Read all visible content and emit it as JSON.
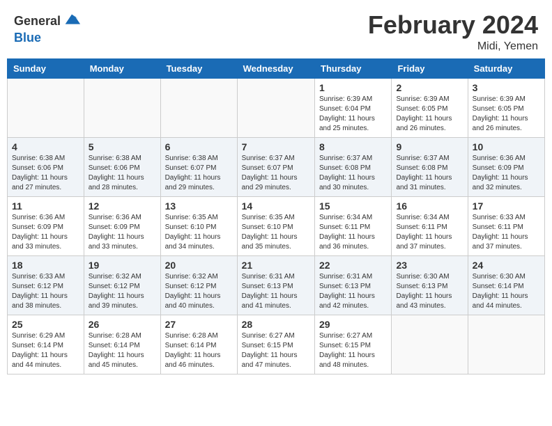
{
  "header": {
    "logo_general": "General",
    "logo_blue": "Blue",
    "month": "February 2024",
    "location": "Midi, Yemen"
  },
  "weekdays": [
    "Sunday",
    "Monday",
    "Tuesday",
    "Wednesday",
    "Thursday",
    "Friday",
    "Saturday"
  ],
  "weeks": [
    [
      {
        "day": "",
        "info": ""
      },
      {
        "day": "",
        "info": ""
      },
      {
        "day": "",
        "info": ""
      },
      {
        "day": "",
        "info": ""
      },
      {
        "day": "1",
        "info": "Sunrise: 6:39 AM\nSunset: 6:04 PM\nDaylight: 11 hours\nand 25 minutes."
      },
      {
        "day": "2",
        "info": "Sunrise: 6:39 AM\nSunset: 6:05 PM\nDaylight: 11 hours\nand 26 minutes."
      },
      {
        "day": "3",
        "info": "Sunrise: 6:39 AM\nSunset: 6:05 PM\nDaylight: 11 hours\nand 26 minutes."
      }
    ],
    [
      {
        "day": "4",
        "info": "Sunrise: 6:38 AM\nSunset: 6:06 PM\nDaylight: 11 hours\nand 27 minutes."
      },
      {
        "day": "5",
        "info": "Sunrise: 6:38 AM\nSunset: 6:06 PM\nDaylight: 11 hours\nand 28 minutes."
      },
      {
        "day": "6",
        "info": "Sunrise: 6:38 AM\nSunset: 6:07 PM\nDaylight: 11 hours\nand 29 minutes."
      },
      {
        "day": "7",
        "info": "Sunrise: 6:37 AM\nSunset: 6:07 PM\nDaylight: 11 hours\nand 29 minutes."
      },
      {
        "day": "8",
        "info": "Sunrise: 6:37 AM\nSunset: 6:08 PM\nDaylight: 11 hours\nand 30 minutes."
      },
      {
        "day": "9",
        "info": "Sunrise: 6:37 AM\nSunset: 6:08 PM\nDaylight: 11 hours\nand 31 minutes."
      },
      {
        "day": "10",
        "info": "Sunrise: 6:36 AM\nSunset: 6:09 PM\nDaylight: 11 hours\nand 32 minutes."
      }
    ],
    [
      {
        "day": "11",
        "info": "Sunrise: 6:36 AM\nSunset: 6:09 PM\nDaylight: 11 hours\nand 33 minutes."
      },
      {
        "day": "12",
        "info": "Sunrise: 6:36 AM\nSunset: 6:09 PM\nDaylight: 11 hours\nand 33 minutes."
      },
      {
        "day": "13",
        "info": "Sunrise: 6:35 AM\nSunset: 6:10 PM\nDaylight: 11 hours\nand 34 minutes."
      },
      {
        "day": "14",
        "info": "Sunrise: 6:35 AM\nSunset: 6:10 PM\nDaylight: 11 hours\nand 35 minutes."
      },
      {
        "day": "15",
        "info": "Sunrise: 6:34 AM\nSunset: 6:11 PM\nDaylight: 11 hours\nand 36 minutes."
      },
      {
        "day": "16",
        "info": "Sunrise: 6:34 AM\nSunset: 6:11 PM\nDaylight: 11 hours\nand 37 minutes."
      },
      {
        "day": "17",
        "info": "Sunrise: 6:33 AM\nSunset: 6:11 PM\nDaylight: 11 hours\nand 37 minutes."
      }
    ],
    [
      {
        "day": "18",
        "info": "Sunrise: 6:33 AM\nSunset: 6:12 PM\nDaylight: 11 hours\nand 38 minutes."
      },
      {
        "day": "19",
        "info": "Sunrise: 6:32 AM\nSunset: 6:12 PM\nDaylight: 11 hours\nand 39 minutes."
      },
      {
        "day": "20",
        "info": "Sunrise: 6:32 AM\nSunset: 6:12 PM\nDaylight: 11 hours\nand 40 minutes."
      },
      {
        "day": "21",
        "info": "Sunrise: 6:31 AM\nSunset: 6:13 PM\nDaylight: 11 hours\nand 41 minutes."
      },
      {
        "day": "22",
        "info": "Sunrise: 6:31 AM\nSunset: 6:13 PM\nDaylight: 11 hours\nand 42 minutes."
      },
      {
        "day": "23",
        "info": "Sunrise: 6:30 AM\nSunset: 6:13 PM\nDaylight: 11 hours\nand 43 minutes."
      },
      {
        "day": "24",
        "info": "Sunrise: 6:30 AM\nSunset: 6:14 PM\nDaylight: 11 hours\nand 44 minutes."
      }
    ],
    [
      {
        "day": "25",
        "info": "Sunrise: 6:29 AM\nSunset: 6:14 PM\nDaylight: 11 hours\nand 44 minutes."
      },
      {
        "day": "26",
        "info": "Sunrise: 6:28 AM\nSunset: 6:14 PM\nDaylight: 11 hours\nand 45 minutes."
      },
      {
        "day": "27",
        "info": "Sunrise: 6:28 AM\nSunset: 6:14 PM\nDaylight: 11 hours\nand 46 minutes."
      },
      {
        "day": "28",
        "info": "Sunrise: 6:27 AM\nSunset: 6:15 PM\nDaylight: 11 hours\nand 47 minutes."
      },
      {
        "day": "29",
        "info": "Sunrise: 6:27 AM\nSunset: 6:15 PM\nDaylight: 11 hours\nand 48 minutes."
      },
      {
        "day": "",
        "info": ""
      },
      {
        "day": "",
        "info": ""
      }
    ]
  ]
}
